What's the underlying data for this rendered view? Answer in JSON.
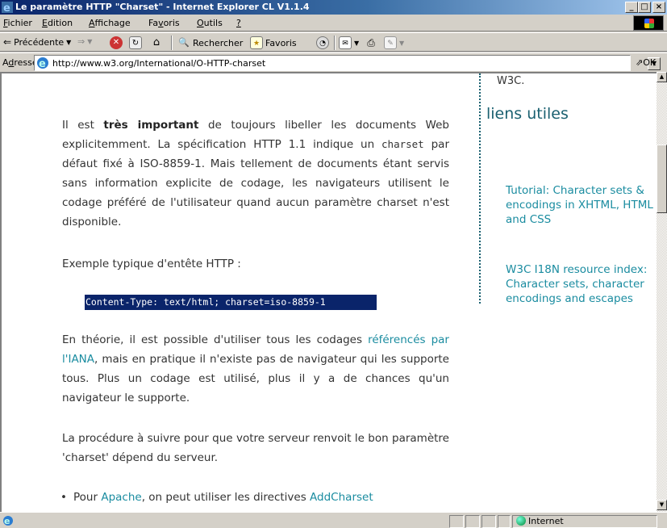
{
  "window": {
    "title": "Le paramètre HTTP \"Charset\" - Internet Explorer CL V1.1.4",
    "minimize": "_",
    "maximize": "□",
    "close": "×"
  },
  "menu": {
    "items": [
      {
        "pre": "",
        "u": "F",
        "post": "ichier"
      },
      {
        "pre": "",
        "u": "E",
        "post": "dition"
      },
      {
        "pre": "",
        "u": "A",
        "post": "ffichage"
      },
      {
        "pre": "Fa",
        "u": "v",
        "post": "oris"
      },
      {
        "pre": "",
        "u": "O",
        "post": "utils"
      },
      {
        "pre": "",
        "u": "?",
        "post": ""
      }
    ]
  },
  "toolbar": {
    "back": "Précédente",
    "search": "Rechercher",
    "favorites": "Favoris"
  },
  "address": {
    "label_pre": "A",
    "label_u": "d",
    "label_post": "resse",
    "url": "http://www.w3.org/International/O-HTTP-charset",
    "go": "OK"
  },
  "page": {
    "p1_a": "Il est ",
    "p1_b": "très important",
    "p1_c": " de toujours libeller les documents Web explicitemment. La spécification HTTP 1.1 indique un ",
    "p1_d": "charset",
    "p1_e": " par défaut fixé à ISO-8859-1. Mais tellement de documents étant servis sans information explicite de codage, les navigateurs utilisent le codage préféré de l'utilisateur quand aucun paramètre charset n'est disponible.",
    "p2": "Exemple typique d'entête HTTP :",
    "code": "Content-Type: text/html; charset=iso-8859-1",
    "p3_a": "En théorie, il est possible d'utiliser tous les codages ",
    "p3_link": "référencés par l'IANA",
    "p3_b": ", mais en pratique il n'existe pas de navigateur qui les supporte tous. Plus un codage est utilisé, plus il y a de chances qu'un navigateur le supporte.",
    "p4": "La procédure à suivre pour que votre serveur renvoit le bon paramètre 'charset' dépend du serveur.",
    "li1_a": "Pour ",
    "li1_link1": "Apache",
    "li1_b": ", on peut utiliser les directives ",
    "li1_link2": "AddCharset"
  },
  "sidebar": {
    "top": "W3C.",
    "title": "liens utiles",
    "links": [
      "Tutorial: Character sets & encodings in XHTML, HTML and CSS",
      "W3C I18N resource index: Character sets, character encodings and escapes"
    ]
  },
  "status": {
    "zone": "Internet"
  }
}
